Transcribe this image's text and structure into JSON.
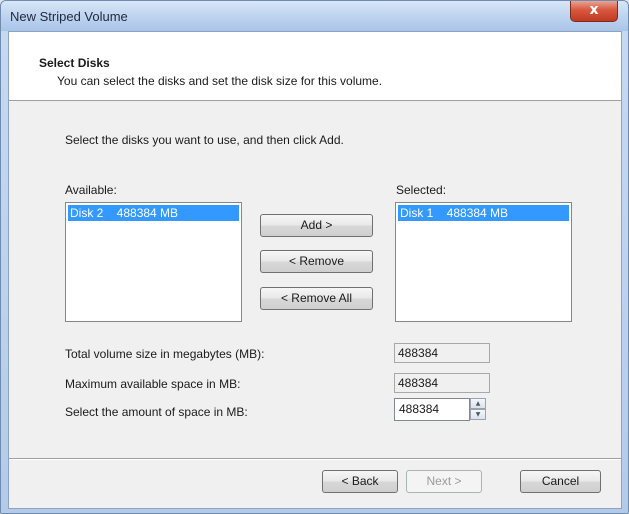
{
  "window": {
    "title": "New Striped Volume",
    "close_label": "x"
  },
  "header": {
    "title": "Select Disks",
    "subtitle": "You can select the disks and set the disk size for this volume."
  },
  "instruction": "Select the disks you want to use, and then click Add.",
  "available": {
    "label": "Available:",
    "items": [
      "Disk 2    488384 MB"
    ]
  },
  "selected": {
    "label": "Selected:",
    "items": [
      "Disk 1    488384 MB"
    ]
  },
  "transfer": {
    "add": "Add >",
    "remove": "< Remove",
    "remove_all": "< Remove All"
  },
  "sizes": {
    "total_label": "Total volume size in megabytes (MB):",
    "total_value": "488384",
    "max_label": "Maximum available space in MB:",
    "max_value": "488384",
    "amount_label": "Select the amount of space in MB:",
    "amount_value": "488384"
  },
  "footer": {
    "back": "< Back",
    "next": "Next >",
    "cancel": "Cancel"
  }
}
